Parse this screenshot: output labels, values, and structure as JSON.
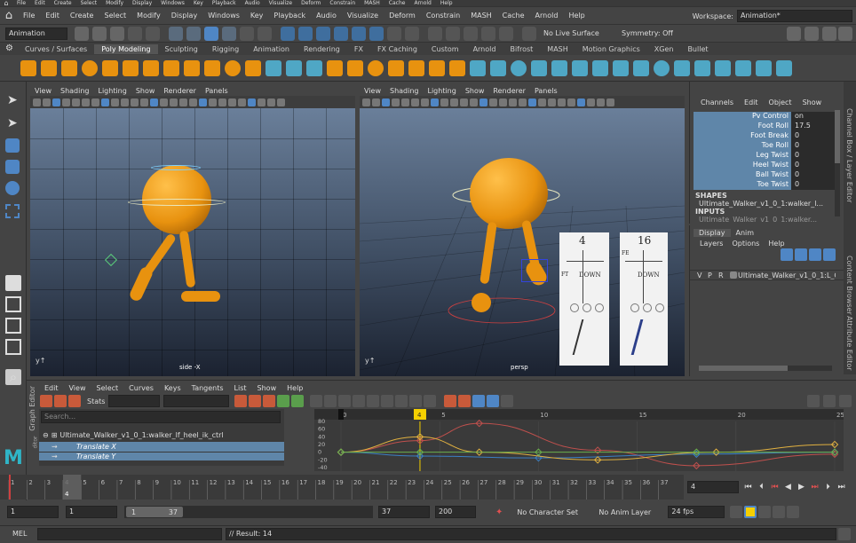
{
  "os_menu": [
    "File",
    "Edit",
    "Create",
    "Select",
    "Modify",
    "Display",
    "Windows",
    "Key",
    "Playback",
    "Audio",
    "Visualize",
    "Deform",
    "Constrain",
    "MASH",
    "Cache",
    "Arnold",
    "Help"
  ],
  "workspace_label": "Workspace:",
  "workspace_value": "Animation*",
  "main_menu": [
    "File",
    "Edit",
    "Create",
    "Select",
    "Modify",
    "Display",
    "Windows",
    "Key",
    "Playback",
    "Audio",
    "Visualize",
    "Deform",
    "Constrain",
    "MASH",
    "Cache",
    "Arnold",
    "Help"
  ],
  "status_line": {
    "menuset": "Animation",
    "live_surface": "No Live Surface",
    "symmetry": "Symmetry: Off"
  },
  "shelf_tabs": [
    "Curves / Surfaces",
    "Poly Modeling",
    "Sculpting",
    "Rigging",
    "Animation",
    "Rendering",
    "FX",
    "FX Caching",
    "Custom",
    "Arnold",
    "Bifrost",
    "MASH",
    "Motion Graphics",
    "XGen",
    "Bullet"
  ],
  "shelf_active": "Poly Modeling",
  "viewport_menu": [
    "View",
    "Shading",
    "Lighting",
    "Show",
    "Renderer",
    "Panels"
  ],
  "viewport_left_label": "side -X",
  "viewport_right_label": "persp",
  "channel_box": {
    "menu": [
      "Channels",
      "Edit",
      "Object",
      "Show"
    ],
    "rows": [
      {
        "name": "Pv Control",
        "value": "on"
      },
      {
        "name": "Foot Roll",
        "value": "17.5"
      },
      {
        "name": "Foot Break",
        "value": "0"
      },
      {
        "name": "Toe Roll",
        "value": "0"
      },
      {
        "name": "Leg Twist",
        "value": "0"
      },
      {
        "name": "Heel Twist",
        "value": "0"
      },
      {
        "name": "Ball Twist",
        "value": "0"
      },
      {
        "name": "Toe Twist",
        "value": "0"
      }
    ],
    "shapes_header": "SHAPES",
    "shapes_item": "Ultimate_Walker_v1_0_1:walker_l...",
    "inputs_header": "INPUTS",
    "inputs_item": "Ultimate_Walker_v1_0_1:walker..."
  },
  "side_tabs": [
    "Channel Box / Layer Editor",
    "Content Browser",
    "Attribute Editor"
  ],
  "layer_editor": {
    "tabs": [
      "Display",
      "Anim"
    ],
    "menu": [
      "Layers",
      "Options",
      "Help"
    ],
    "layer_v": "V",
    "layer_p": "P",
    "layer_r": "R",
    "layer_name": "Ultimate_Walker_v1_0_1:L_Ob"
  },
  "ref_images": [
    {
      "frame": "4",
      "label": "DOWN",
      "mark": "FT"
    },
    {
      "frame": "16",
      "label": "DOWN",
      "mark": "FE"
    }
  ],
  "graph_editor": {
    "title": "Graph Editor",
    "menu": [
      "Edit",
      "View",
      "Select",
      "Curves",
      "Keys",
      "Tangents",
      "List",
      "Show",
      "Help"
    ],
    "stats_label": "Stats",
    "search_placeholder": "Search...",
    "outliner_items": [
      "Ultimate_Walker_v1_0_1:walker_lf_heel_ik_ctrl",
      "Translate X",
      "Translate Y"
    ],
    "side_label": "ditor",
    "ruler_labels": [
      "0",
      "5",
      "10",
      "15",
      "20",
      "25"
    ],
    "ruler_values": [
      0,
      5,
      10,
      15,
      20,
      25
    ],
    "current_frame": "4",
    "value_labels": [
      "80",
      "60",
      "40",
      "20",
      "0",
      "-20",
      "-40"
    ]
  },
  "chart_data": {
    "type": "line",
    "xlim": [
      0,
      25
    ],
    "ylim": [
      -40,
      80
    ],
    "series": [
      {
        "color": "#c0504d",
        "x": [
          0,
          4,
          7,
          13,
          18,
          25
        ],
        "y": [
          0,
          30,
          75,
          5,
          -35,
          -5
        ]
      },
      {
        "color": "#3b7fc4",
        "x": [
          0,
          4,
          10,
          18,
          25
        ],
        "y": [
          0,
          -10,
          -15,
          -5,
          0
        ]
      },
      {
        "color": "#e0b040",
        "x": [
          0,
          4,
          7,
          13,
          19,
          25
        ],
        "y": [
          0,
          40,
          0,
          -20,
          0,
          20
        ]
      },
      {
        "color": "#6ab04c",
        "x": [
          0,
          4,
          10,
          18,
          25
        ],
        "y": [
          0,
          0,
          0,
          0,
          0
        ]
      }
    ]
  },
  "timeline": {
    "labels": [
      "1",
      "2",
      "3",
      "4",
      "5",
      "6",
      "7",
      "8",
      "9",
      "10",
      "11",
      "12",
      "13",
      "14",
      "15",
      "16",
      "17",
      "18",
      "19",
      "20",
      "21",
      "22",
      "23",
      "24",
      "25",
      "26",
      "27",
      "28",
      "29",
      "30",
      "31",
      "32",
      "33",
      "34",
      "35",
      "36",
      "37"
    ],
    "current_frame": "4",
    "current_field": "4"
  },
  "range_slider": {
    "start": "1",
    "playback_start": "1",
    "slider_start": "1",
    "slider_end": "37",
    "playback_end": "37",
    "end": "200",
    "character_set": "No Character Set",
    "anim_layer": "No Anim Layer",
    "fps": "24 fps"
  },
  "command_line": {
    "lang": "MEL",
    "result": "// Result: 14"
  },
  "colors": {
    "accent": "#5f86a9",
    "character": "#e8920f",
    "keyframe_marker": "#f5d000"
  }
}
